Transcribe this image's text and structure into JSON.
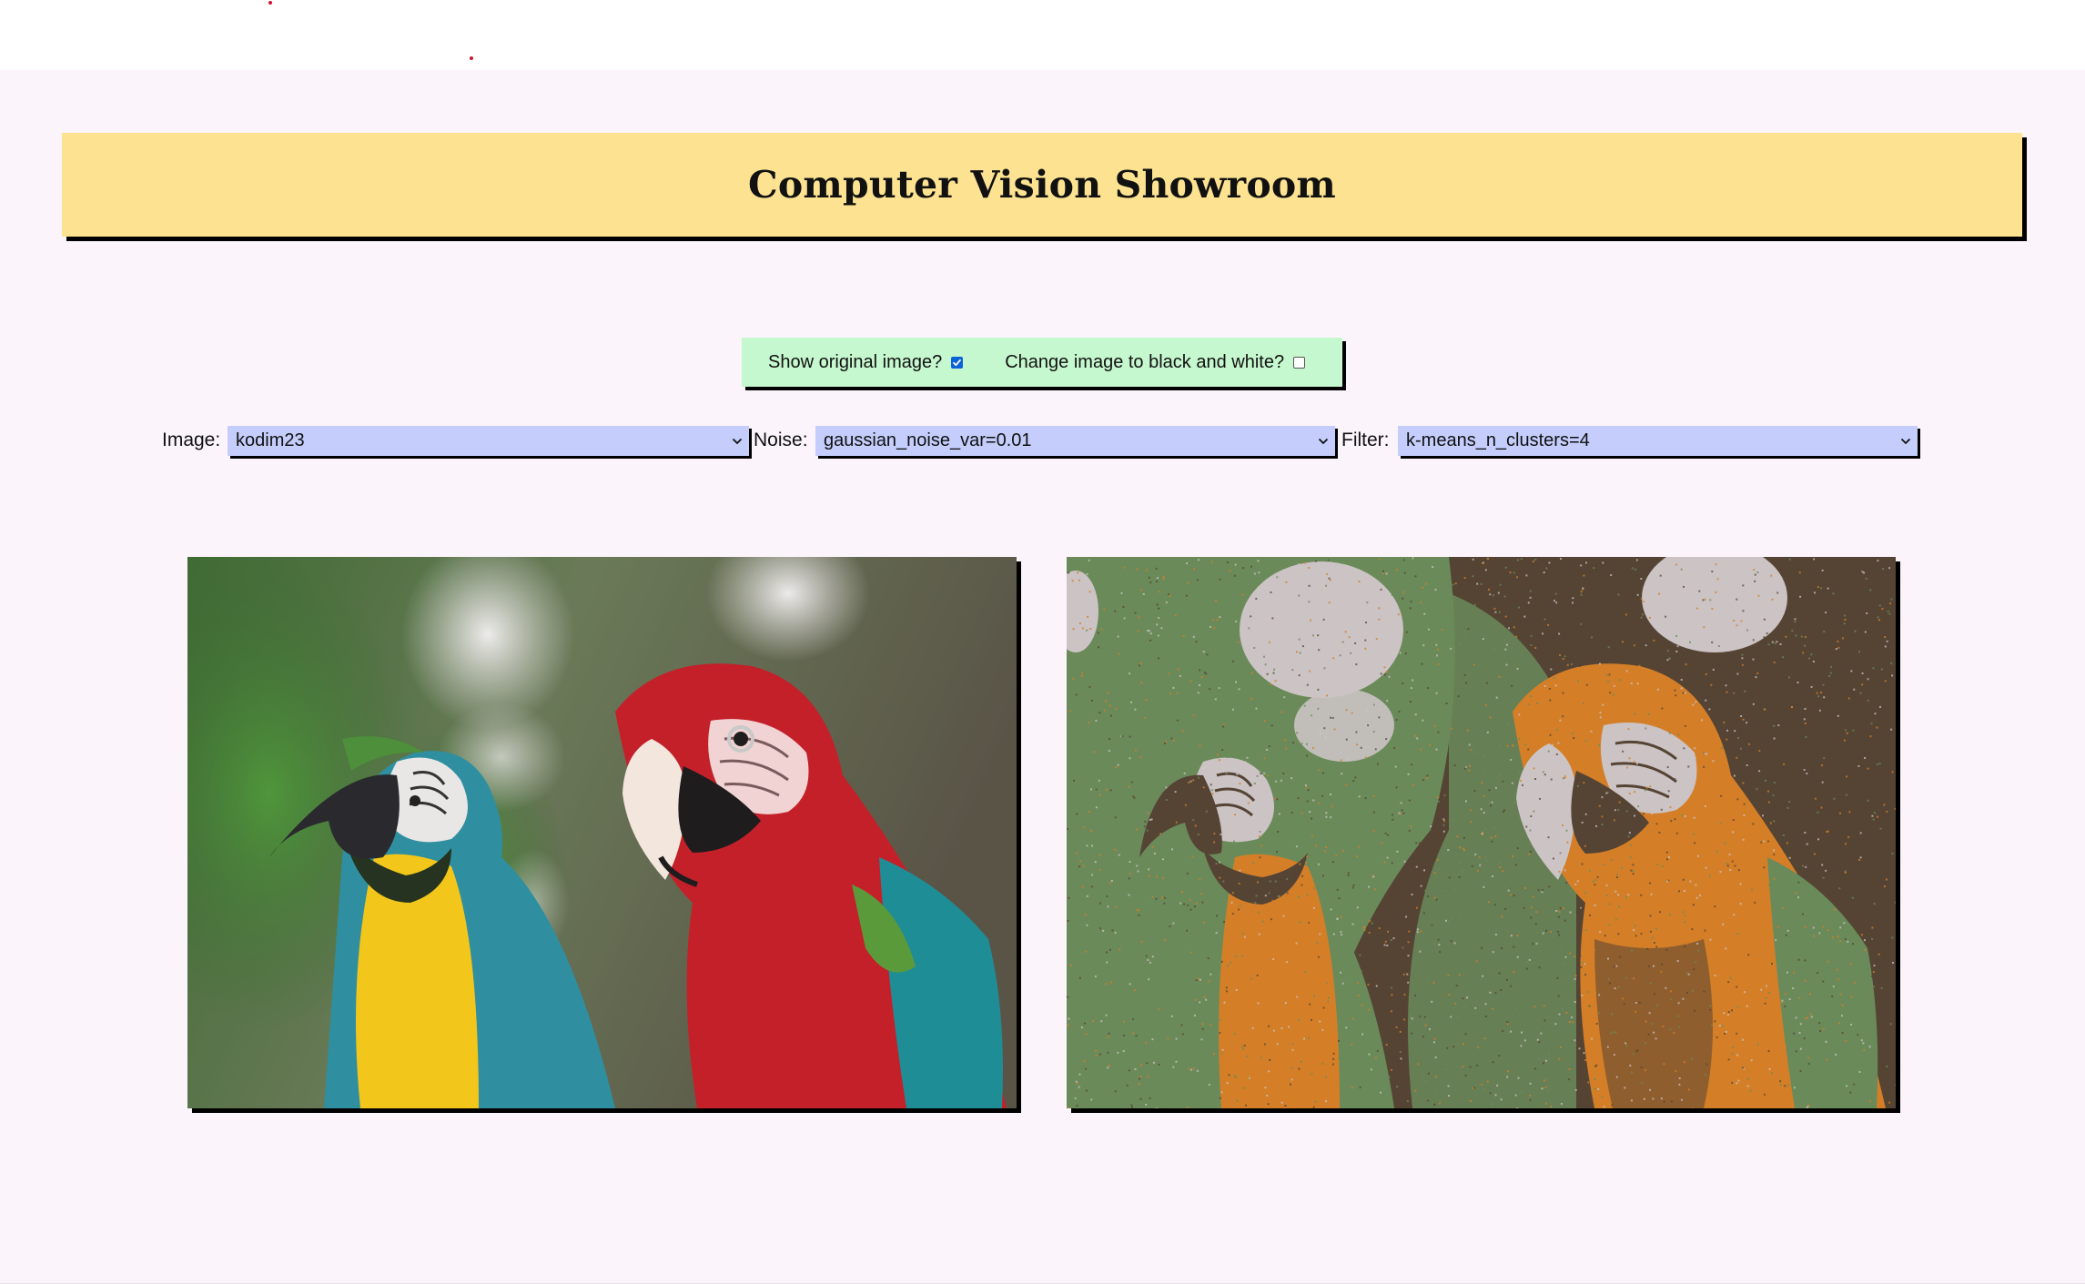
{
  "header": {
    "title": "Computer Vision Showroom"
  },
  "options": {
    "show_original_label": "Show original image?",
    "show_original_checked": true,
    "black_white_label": "Change image to black and white?",
    "black_white_checked": false
  },
  "controls": {
    "image_label": "Image:",
    "image_value": "kodim23",
    "noise_label": "Noise:",
    "noise_value": "gaussian_noise_var=0.01",
    "filter_label": "Filter:",
    "filter_value": "k-means_n_clusters=4"
  },
  "colors": {
    "page_background": "#fbf4fa",
    "header_background": "#fde391",
    "options_background": "#c6f8cf",
    "select_background": "#c4cdfb",
    "checkbox_accent": "#0b63d8",
    "kmeans_palette": [
      "#554434",
      "#6b8a5a",
      "#d47f27",
      "#cbc3c4"
    ]
  },
  "icons": {
    "select_indicator": "chevron-down-icon",
    "checkbox_mark": "checkmark-icon"
  }
}
